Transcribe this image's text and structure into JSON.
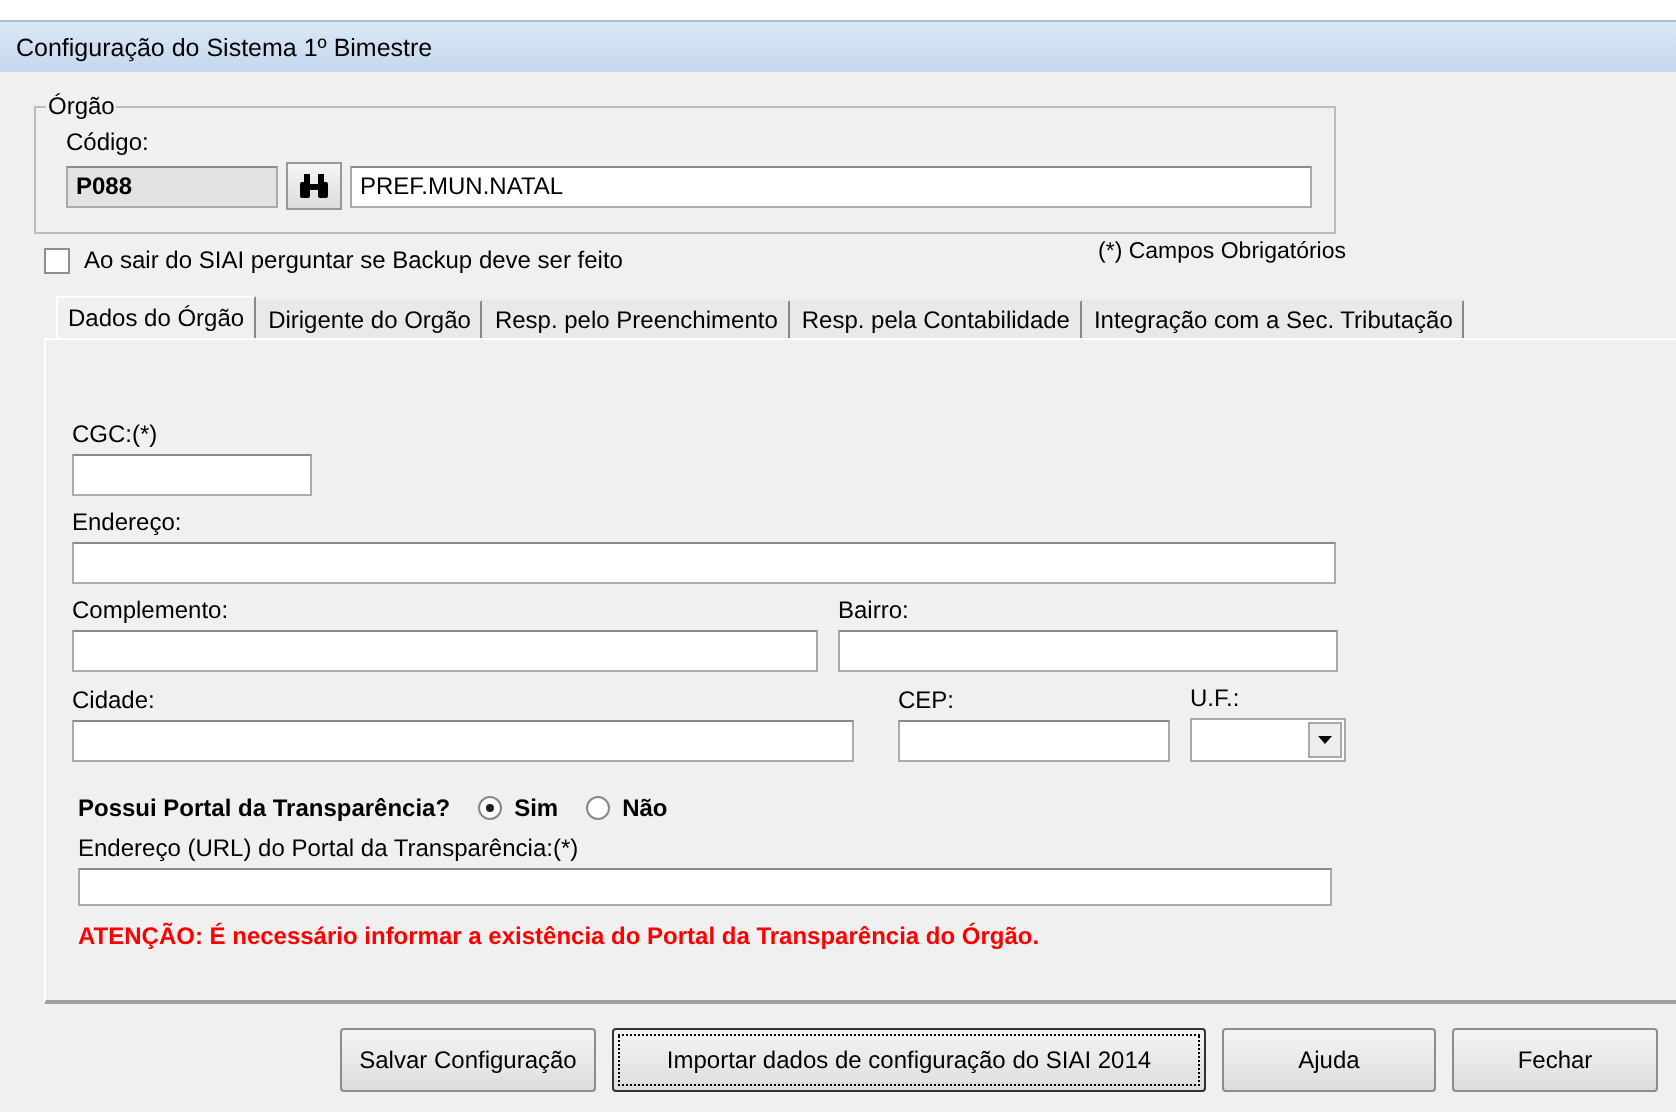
{
  "window": {
    "title": "Configuração do Sistema 1º Bimestre"
  },
  "orgao": {
    "legend": "Órgão",
    "code_label": "Código:",
    "code": "P088",
    "name": "PREF.MUN.NATAL"
  },
  "backup_checkbox": {
    "label": "Ao sair do SIAI perguntar se Backup deve ser feito",
    "checked": false
  },
  "required_note": "(*) Campos Obrigatórios",
  "tabs": [
    {
      "label": "Dados do Órgão",
      "selected": true
    },
    {
      "label": "Dirigente do Orgão",
      "selected": false
    },
    {
      "label": "Resp. pelo Preenchimento",
      "selected": false
    },
    {
      "label": "Resp. pela Contabilidade",
      "selected": false
    },
    {
      "label": "Integração com a Sec. Tributação",
      "selected": false
    }
  ],
  "fields": {
    "cgc": "CGC:(*)",
    "endereco": "Endereço:",
    "complemento": "Complemento:",
    "bairro": "Bairro:",
    "cidade": "Cidade:",
    "cep": "CEP:",
    "uf": "U.F.:"
  },
  "portal": {
    "question": "Possui Portal da Transparência?",
    "options": [
      {
        "label": "Sim",
        "selected": true
      },
      {
        "label": "Não",
        "selected": false
      }
    ],
    "url_label": "Endereço (URL) do Portal da Transparência:(*)"
  },
  "warning": "ATENÇÃO: É necessário informar a existência do Portal da Transparência do Órgão.",
  "buttons": [
    {
      "label": "Salvar Configuração",
      "focused": false
    },
    {
      "label": "Importar dados de configuração do SIAI 2014",
      "focused": true
    },
    {
      "label": "Ajuda",
      "focused": false
    },
    {
      "label": "Fechar",
      "focused": false
    }
  ]
}
